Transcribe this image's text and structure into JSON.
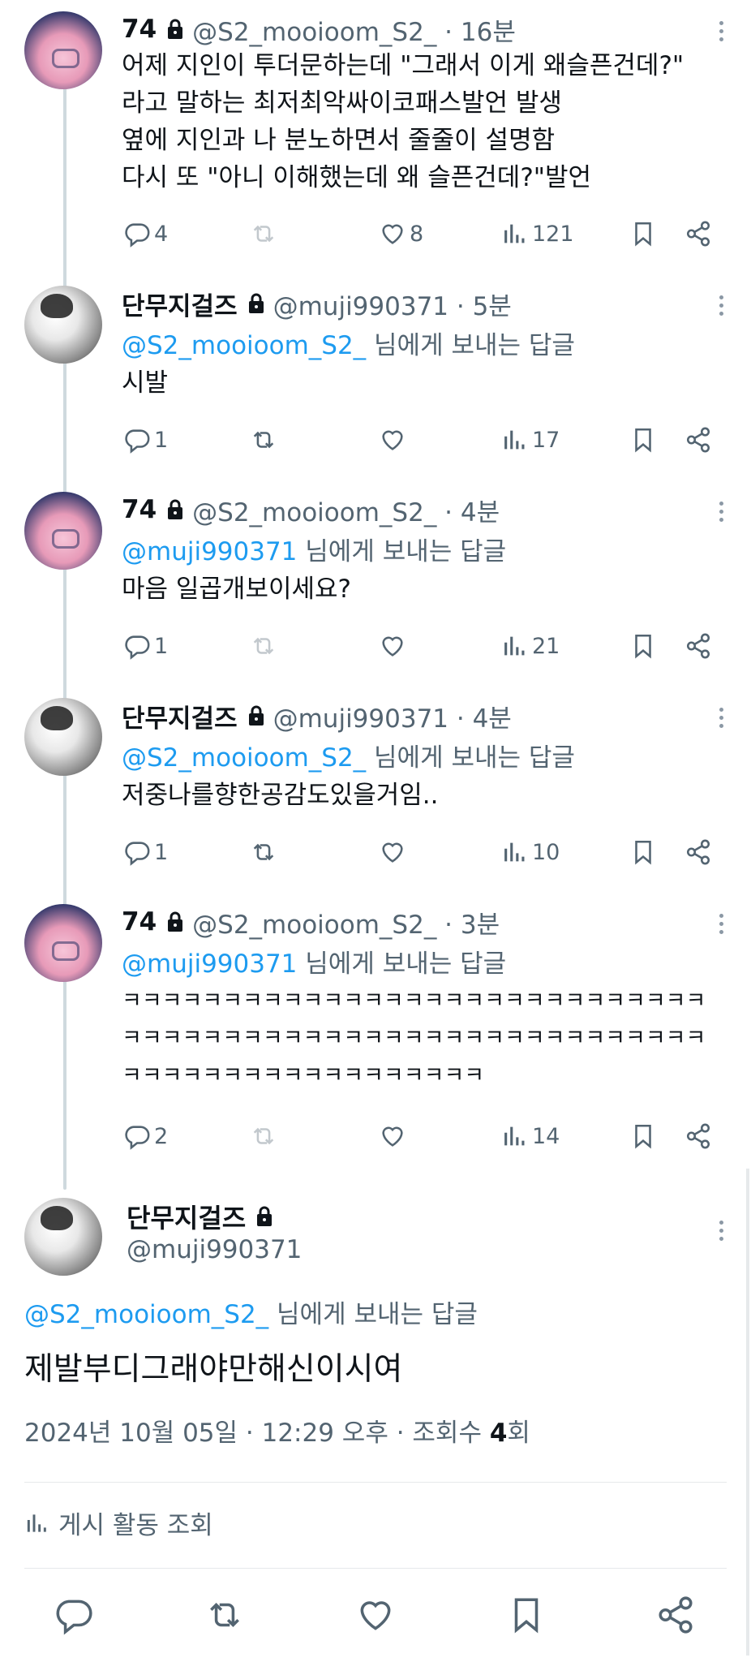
{
  "thread": [
    {
      "name": "74",
      "handle": "@S2_mooioom_S2_ · 16분",
      "reply_to": "",
      "reply_suffix": "",
      "text": "어제 지인이 투더문하는데 \"그래서 이게 왜슬픈건데?\"\n라고 말하는 최저최악싸이코패스발언 발생\n옆에 지인과 나 분노하면서 줄줄이 설명함\n다시 또 \"아니 이해했는데 왜 슬픈건데?\"발언",
      "replies": "4",
      "retweets": "",
      "likes": "8",
      "views": "121"
    },
    {
      "name": "단무지걸즈",
      "handle": "@muji990371 · 5분",
      "reply_to": "@S2_mooioom_S2_",
      "reply_suffix": " 님에게 보내는 답글",
      "text": "시발",
      "replies": "1",
      "retweets": "",
      "likes": "",
      "views": "17"
    },
    {
      "name": "74",
      "handle": "@S2_mooioom_S2_ · 4분",
      "reply_to": "@muji990371",
      "reply_suffix": " 님에게 보내는 답글",
      "text": "마음 일곱개보이세요?",
      "replies": "1",
      "retweets": "",
      "likes": "",
      "views": "21"
    },
    {
      "name": "단무지걸즈",
      "handle": "@muji990371 · 4분",
      "reply_to": "@S2_mooioom_S2_",
      "reply_suffix": " 님에게 보내는 답글",
      "text": "저중나를향한공감도있을거임..",
      "replies": "1",
      "retweets": "",
      "likes": "",
      "views": "10"
    },
    {
      "name": "74",
      "handle": "@S2_mooioom_S2_ · 3분",
      "reply_to": "@muji990371",
      "reply_suffix": " 님에게 보내는 답글",
      "text": "ㅋㅋㅋㅋㅋㅋㅋㅋㅋㅋㅋㅋㅋㅋㅋㅋㅋㅋㅋㅋㅋㅋㅋㅋㅋㅋㅋㅋㅋ\nㅋㅋㅋㅋㅋㅋㅋㅋㅋㅋㅋㅋㅋㅋㅋㅋㅋㅋㅋㅋㅋㅋㅋㅋㅋㅋㅋㅋㅋ\nㅋㅋㅋㅋㅋㅋㅋㅋㅋㅋㅋㅋㅋㅋㅋㅋㅋㅋ",
      "replies": "2",
      "retweets": "",
      "likes": "",
      "views": "14"
    }
  ],
  "main": {
    "name": "단무지걸즈",
    "handle": "@muji990371",
    "reply_to": "@S2_mooioom_S2_",
    "reply_suffix": " 님에게 보내는 답글",
    "text": "제발부디그래야만해신이시여",
    "meta_prefix": "2024년 10월 05일 · 12:29 오후 · 조회수 ",
    "views": "4",
    "views_suffix": "회",
    "activity_label": "게시 활동 조회"
  },
  "colors": {
    "accent": "#1d9bf0",
    "muted": "#536471",
    "text": "#0f1419"
  },
  "icons": [
    "reply-icon",
    "retweet-icon",
    "like-icon",
    "views-icon",
    "bookmark-icon",
    "share-icon",
    "lock-icon",
    "more-icon"
  ]
}
